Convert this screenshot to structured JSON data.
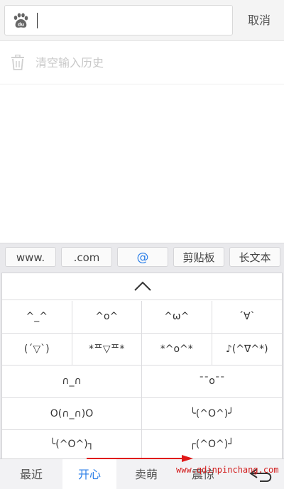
{
  "search": {
    "cancel_label": "取消",
    "value": ""
  },
  "history": {
    "clear_label": "清空输入历史"
  },
  "suggestions": [
    "www.",
    ".com",
    "@",
    "剪贴板",
    "长文本"
  ],
  "emoticons": {
    "rows4": [
      [
        "^_^",
        "^o^",
        "^ω^",
        "´∀`"
      ],
      [
        "(´▽`)",
        "*ᄑ▽ᄑ*",
        "*^o^*",
        "♪(^∇^*)"
      ]
    ],
    "rows2": [
      [
        "∩_∩",
        "¯¯o¯¯"
      ],
      [
        "O(∩_∩)O",
        "╰(^O^)╯"
      ],
      [
        "╰(^O^)┐",
        "┌(^O^)┘"
      ]
    ]
  },
  "tabs": [
    {
      "label": "最近",
      "active": false
    },
    {
      "label": "开心",
      "active": true
    },
    {
      "label": "卖萌",
      "active": false
    },
    {
      "label": "震惊",
      "active": false
    }
  ],
  "watermark": "www.qdinpinchang.com",
  "colors": {
    "accent": "#2a7ee8",
    "watermark": "#d21c1c"
  }
}
